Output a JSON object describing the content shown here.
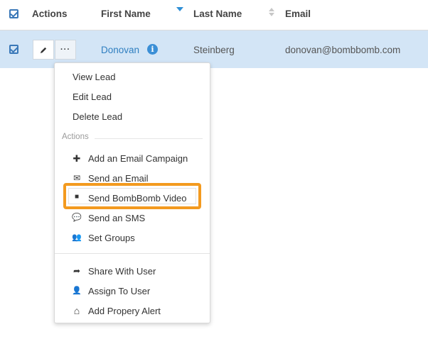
{
  "table": {
    "columns": {
      "actions": "Actions",
      "first_name": "First Name",
      "last_name": "Last Name",
      "email": "Email"
    },
    "row": {
      "first_name": "Donovan",
      "last_name": "Steinberg",
      "email": "donovan@bombbomb.com",
      "edit_icon": "pencil-icon",
      "more_label": "···",
      "info_label": "i"
    }
  },
  "menu": {
    "top_items": [
      "View Lead",
      "Edit Lead",
      "Delete Lead"
    ],
    "section_label": "Actions",
    "action_items": [
      {
        "icon": "plus-icon",
        "glyph": "✚",
        "label": "Add an Email Campaign"
      },
      {
        "icon": "envelope-icon",
        "glyph": "✉",
        "label": "Send an Email"
      },
      {
        "icon": "video-camera-icon",
        "glyph": "■",
        "label": "Send BombBomb Video"
      },
      {
        "icon": "chat-bubble-icon",
        "glyph": "💬",
        "label": "Send an SMS"
      },
      {
        "icon": "users-icon",
        "glyph": "👥",
        "label": "Set Groups"
      }
    ],
    "bottom_items": [
      {
        "icon": "share-arrow-icon",
        "glyph": "➦",
        "label": "Share With User"
      },
      {
        "icon": "user-icon",
        "glyph": "👤",
        "label": "Assign To User"
      },
      {
        "icon": "home-icon",
        "glyph": "⌂",
        "label": "Add Propery Alert"
      }
    ]
  },
  "colors": {
    "selected_row": "#d3e5f6",
    "highlight_border": "#f39a1f",
    "link_blue": "#2f7fc0",
    "checkbox_blue": "#3a78b8"
  }
}
